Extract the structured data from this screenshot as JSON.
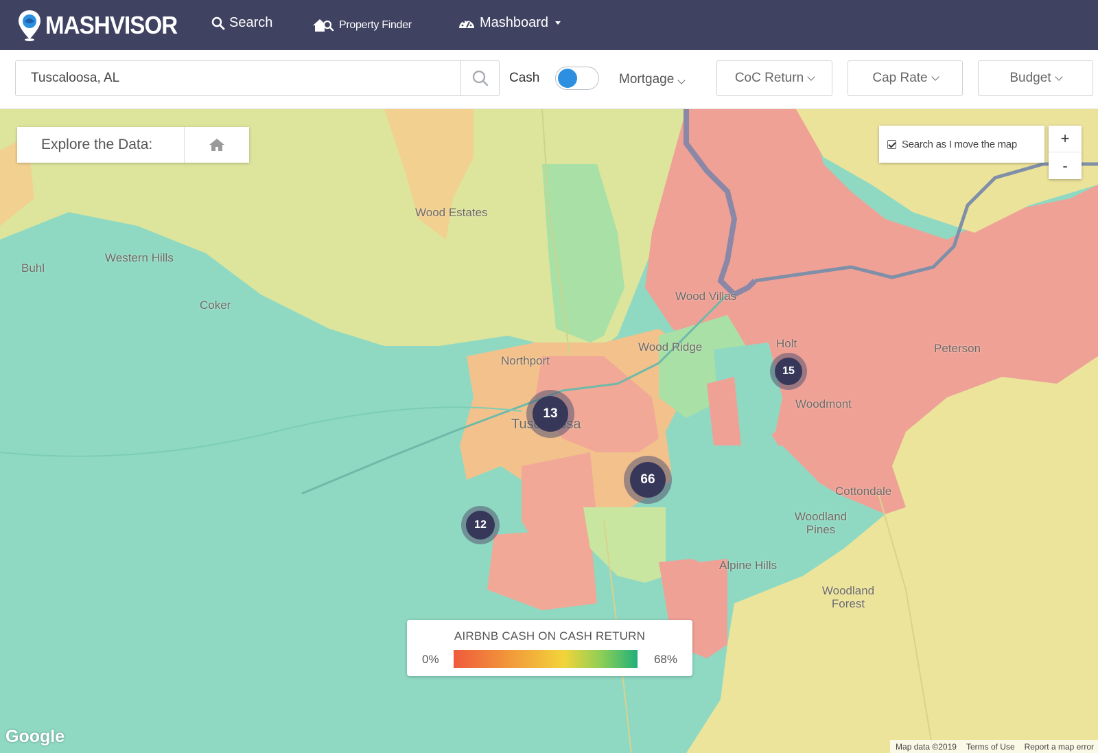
{
  "nav": {
    "brand": "MASHVISOR",
    "search": "Search",
    "property_finder": "Property Finder",
    "mashboard": "Mashboard"
  },
  "filters": {
    "location_value": "Tuscaloosa, AL",
    "cash_label": "Cash",
    "mortgage": "Mortgage",
    "coc_return": "CoC Return",
    "cap_rate": "Cap Rate",
    "budget": "Budget"
  },
  "map": {
    "explore_label": "Explore the Data:",
    "search_as_move": "Search as I move the map",
    "zoom_in": "+",
    "zoom_out": "-",
    "places": [
      "Wood Estates",
      "Western Hills",
      "Buhl",
      "Coker",
      "Wood Villas",
      "Holt",
      "Peterson",
      "Wood Ridge",
      "Northport",
      "Tuscaloosa",
      "Woodmont",
      "Cottondale",
      "Woodland Pines",
      "Alpine Hills",
      "Woodland Forest"
    ],
    "clusters": [
      {
        "count": "13"
      },
      {
        "count": "15"
      },
      {
        "count": "66"
      },
      {
        "count": "12"
      }
    ],
    "legend": {
      "title": "AIRBNB CASH ON CASH RETURN",
      "min": "0%",
      "max": "68%"
    },
    "google_logo": "Google",
    "attribution": {
      "map_data": "Map data ©2019",
      "terms": "Terms of Use",
      "report": "Report a map error"
    }
  },
  "colors": {
    "nav_bg": "#3f4261",
    "teal_zone": "#8fd9c2",
    "yellow_zone": "#e8e59a",
    "orange_zone": "#f2c48c",
    "red_zone": "#f09f93",
    "toggle_knob": "#2d8fe0",
    "cluster": "#37375a"
  }
}
